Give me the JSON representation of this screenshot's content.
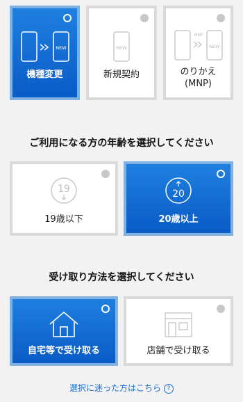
{
  "contract_types": [
    {
      "label": "機種変更",
      "icon_new_text": "NEW",
      "selected": true
    },
    {
      "label": "新規契約",
      "icon_new_text": "NEW",
      "selected": false
    },
    {
      "label_line1": "のりかえ",
      "label_line2": "(MNP)",
      "icon_mnp_text": "MNP",
      "icon_new_text": "NEW",
      "selected": false
    }
  ],
  "age_heading": "ご利用になる方の年齢を選択してください",
  "age_options": [
    {
      "label": "19歳以下",
      "icon_number": "19",
      "selected": false
    },
    {
      "label": "20歳以上",
      "icon_number": "20",
      "selected": true
    }
  ],
  "receive_heading": "受け取り方法を選択してください",
  "receive_options": [
    {
      "label": "自宅等で受け取る",
      "icon": "house-icon",
      "selected": true
    },
    {
      "label": "店舗で受け取る",
      "icon": "store-icon",
      "selected": false
    }
  ],
  "help_link": {
    "label": "選択に迷った方はこちら",
    "icon": "?"
  },
  "colors": {
    "accent": "#0a5bc6",
    "selected_border": "#7fb2e3",
    "unselected_border": "#d9d9d9",
    "link": "#1a6fd6"
  }
}
